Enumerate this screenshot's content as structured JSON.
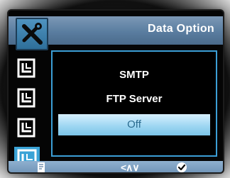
{
  "header": {
    "title": "Data Option",
    "icon": "tools-icon"
  },
  "sidebar": {
    "items": [
      {
        "icon": "menu-page-icon",
        "active": false
      },
      {
        "icon": "menu-page-icon",
        "active": false
      },
      {
        "icon": "menu-page-icon",
        "active": false
      },
      {
        "icon": "menu-page-icon",
        "active": true
      }
    ]
  },
  "options": [
    {
      "label": "SMTP",
      "selected": false
    },
    {
      "label": "FTP Server",
      "selected": false
    },
    {
      "label": "Off",
      "selected": true
    }
  ],
  "footer": {
    "nav_symbols": "<∧∨",
    "left_icon": "memo-icon",
    "ok_icon": "checkmark-icon"
  },
  "colors": {
    "header_bg": "#5a7da0",
    "accent_blue": "#3b9ed6",
    "selected_bg": "#9fd7f2",
    "selected_text": "#2a6b8f"
  }
}
